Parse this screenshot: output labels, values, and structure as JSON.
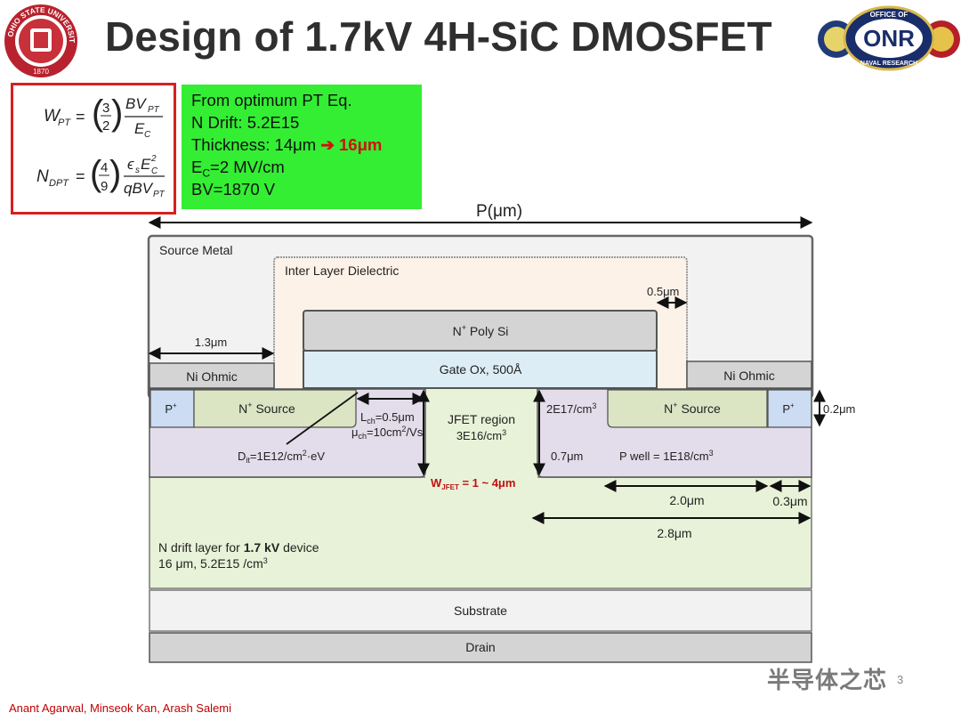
{
  "title": "Design of 1.7kV 4H-SiC DMOSFET",
  "logos": {
    "left_name": "ohio-state-university-seal",
    "left_text": "OHIO STATE UNIVERSITY",
    "left_year": "1870",
    "right_name": "office-of-naval-research-logo",
    "right_text_top": "OFFICE OF",
    "right_text_bottom": "NAVAL RESEARCH",
    "right_core": "ONR"
  },
  "formulas": {
    "wpt_lhs": "W",
    "wpt_sub": "PT",
    "wpt_coef_num": "3",
    "wpt_coef_den": "2",
    "wpt_num": "BV",
    "wpt_num_sub": "PT",
    "wpt_den": "E",
    "wpt_den_sub": "C",
    "ndpt_lhs": "N",
    "ndpt_sub": "DPT",
    "ndpt_coef_num": "4",
    "ndpt_coef_den": "9",
    "ndpt_num": "ϵ",
    "ndpt_num_s": "s",
    "ndpt_num_e": "E",
    "ndpt_num_sup": "2",
    "ndpt_num_sub": "C",
    "ndpt_den": "qBV",
    "ndpt_den_sub": "PT"
  },
  "params": {
    "line1": "From optimum PT Eq.",
    "line2": "N Drift: 5.2E15",
    "line3_prefix": "Thickness: 14μm",
    "line3_arrow": "➔",
    "line3_new": "16μm",
    "line4_prefix": "E",
    "line4_sub": "C",
    "line4_rest": "=2 MV/cm",
    "line5": "BV=1870 V"
  },
  "diagram": {
    "pitch_label": "P(μm)",
    "source_metal": "Source Metal",
    "ild": "Inter Layer  Dielectric",
    "ild_width": "0.5μm",
    "poly": "N",
    "poly_sup": "+",
    "poly_rest": " Poly Si",
    "gate_ox": "Gate Ox, 500Å",
    "metal_offset": "1.3μm",
    "ni_ohmic_left": "Ni Ohmic",
    "ni_ohmic_right": "Ni Ohmic",
    "p_plus": "P",
    "p_plus_sup": "+",
    "n_source": "N",
    "n_source_sup": "+",
    "n_source_rest": " Source",
    "lch_main": "L",
    "lch_sub": "ch",
    "lch_rest": "=0.5μm",
    "mu_main": "μ",
    "mu_sub": "ch",
    "mu_rest": "=10cm",
    "mu_sup": "2",
    "mu_tail": "/Vs",
    "dit_main": "D",
    "dit_sub": "it",
    "dit_rest": "=1E12/cm",
    "dit_sup": "2",
    "dit_tail": "·eV",
    "jfet_title": "JFET region",
    "jfet_doping": "3E16/cm",
    "jfet_doping_sup": "3",
    "jfet_side_doping": "2E17/cm",
    "jfet_side_sup": "3",
    "pwell_depth": "0.7μm",
    "pwell": "P well = 1E18/cm",
    "pwell_sup": "3",
    "wjfet_main": "W",
    "wjfet_sub": "JFET",
    "wjfet_rest": " = 1 ~ 4μm",
    "source_depth": "0.2μm",
    "dim_2_0": "2.0μm",
    "dim_0_3": "0.3μm",
    "dim_2_8": "2.8μm",
    "drift_line1_a": "N drift layer for ",
    "drift_line1_b": "1.7 kV",
    "drift_line1_c": " device",
    "drift_line2": "16 μm, 5.2E15 /cm",
    "drift_line2_sup": "3",
    "substrate": "Substrate",
    "drain": "Drain"
  },
  "footer": {
    "authors": "Anant Agarwal, Minseok Kan, Arash Salemi",
    "watermark": "半导体之芯",
    "page": "3"
  }
}
